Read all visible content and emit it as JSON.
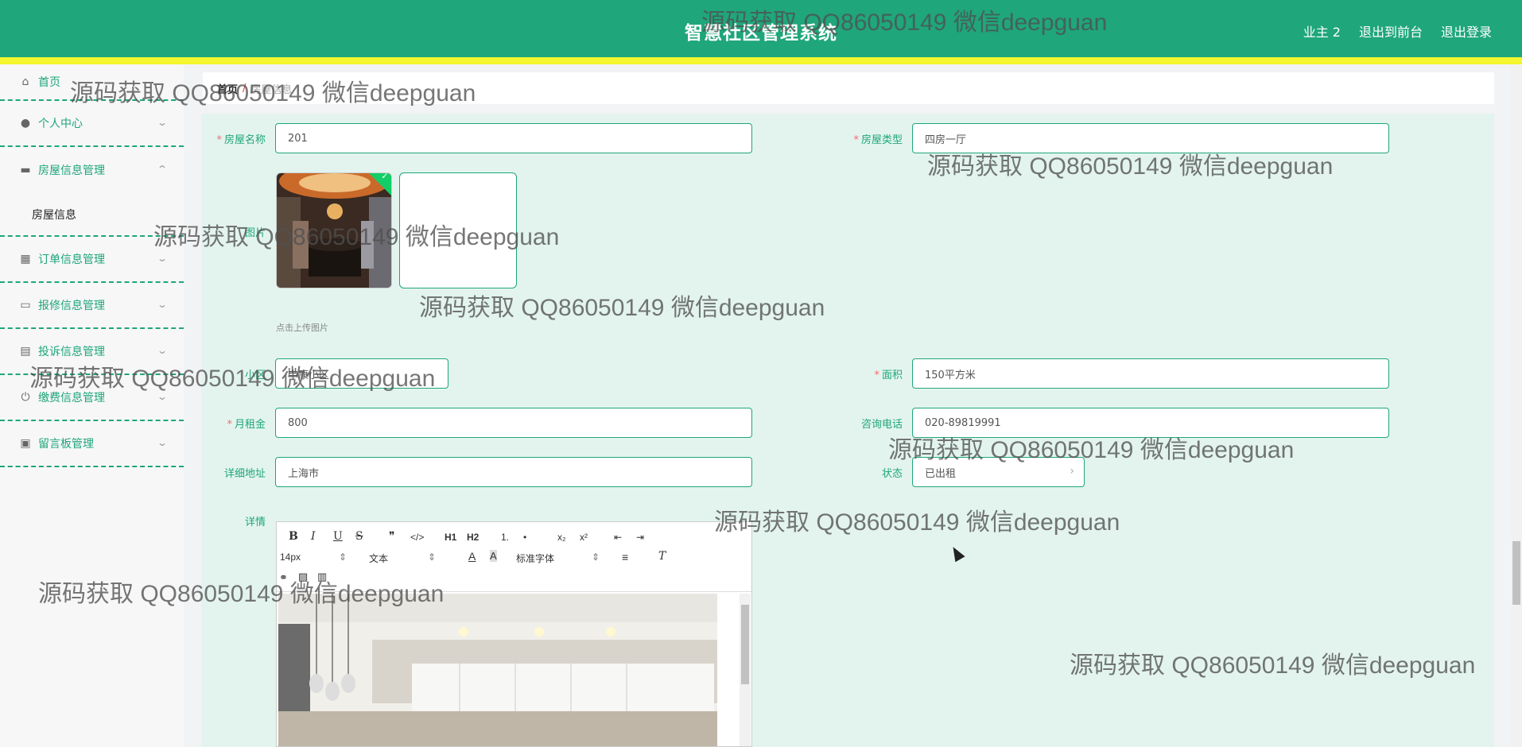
{
  "header": {
    "title": "智慧社区管理系统",
    "links": [
      "业主 2",
      "退出到前台",
      "退出登录"
    ]
  },
  "sidebar": {
    "items": [
      {
        "label": "首页",
        "icon": "home-icon"
      },
      {
        "label": "个人中心",
        "icon": "user-icon"
      },
      {
        "label": "房屋信息管理",
        "icon": "ticket-icon",
        "expanded": true,
        "sub": [
          "房屋信息"
        ]
      },
      {
        "label": "订单信息管理",
        "icon": "grid-icon"
      },
      {
        "label": "报修信息管理",
        "icon": "chat-icon"
      },
      {
        "label": "投诉信息管理",
        "icon": "briefcase-icon"
      },
      {
        "label": "缴费信息管理",
        "icon": "power-icon"
      },
      {
        "label": "留言板管理",
        "icon": "clipboard-icon"
      }
    ]
  },
  "breadcrumb": {
    "home": "首页",
    "sep": "/",
    "current": "房屋信息"
  },
  "form": {
    "house_name": {
      "label": "房屋名称",
      "value": "201"
    },
    "house_type": {
      "label": "房屋类型",
      "value": "四房一厅"
    },
    "image": {
      "label": "图片",
      "hint": "点击上传图片"
    },
    "community": {
      "label": "小区",
      "value": "中康小区"
    },
    "area": {
      "label": "面积",
      "value": "150平方米"
    },
    "rent": {
      "label": "月租金",
      "value": "800"
    },
    "phone": {
      "label": "咨询电话",
      "value": "020-89819991"
    },
    "address": {
      "label": "详细地址",
      "value": "上海市"
    },
    "status": {
      "label": "状态",
      "value": "已出租"
    },
    "detail": {
      "label": "详情"
    }
  },
  "editor": {
    "font_size": "14px",
    "block_type": "文本",
    "font_family": "标准字体",
    "buttons": [
      "B",
      "I",
      "U",
      "S",
      "❞",
      "</>",
      "H1",
      "H2",
      "1.",
      "•",
      "x₂",
      "x²",
      "⇤",
      "⇥"
    ]
  },
  "watermark": "源码获取 QQ86050149 微信deepguan",
  "colors": {
    "primary": "#1fa67a",
    "accent_bar": "#f4f62f",
    "panel": "#e3f4ee"
  }
}
